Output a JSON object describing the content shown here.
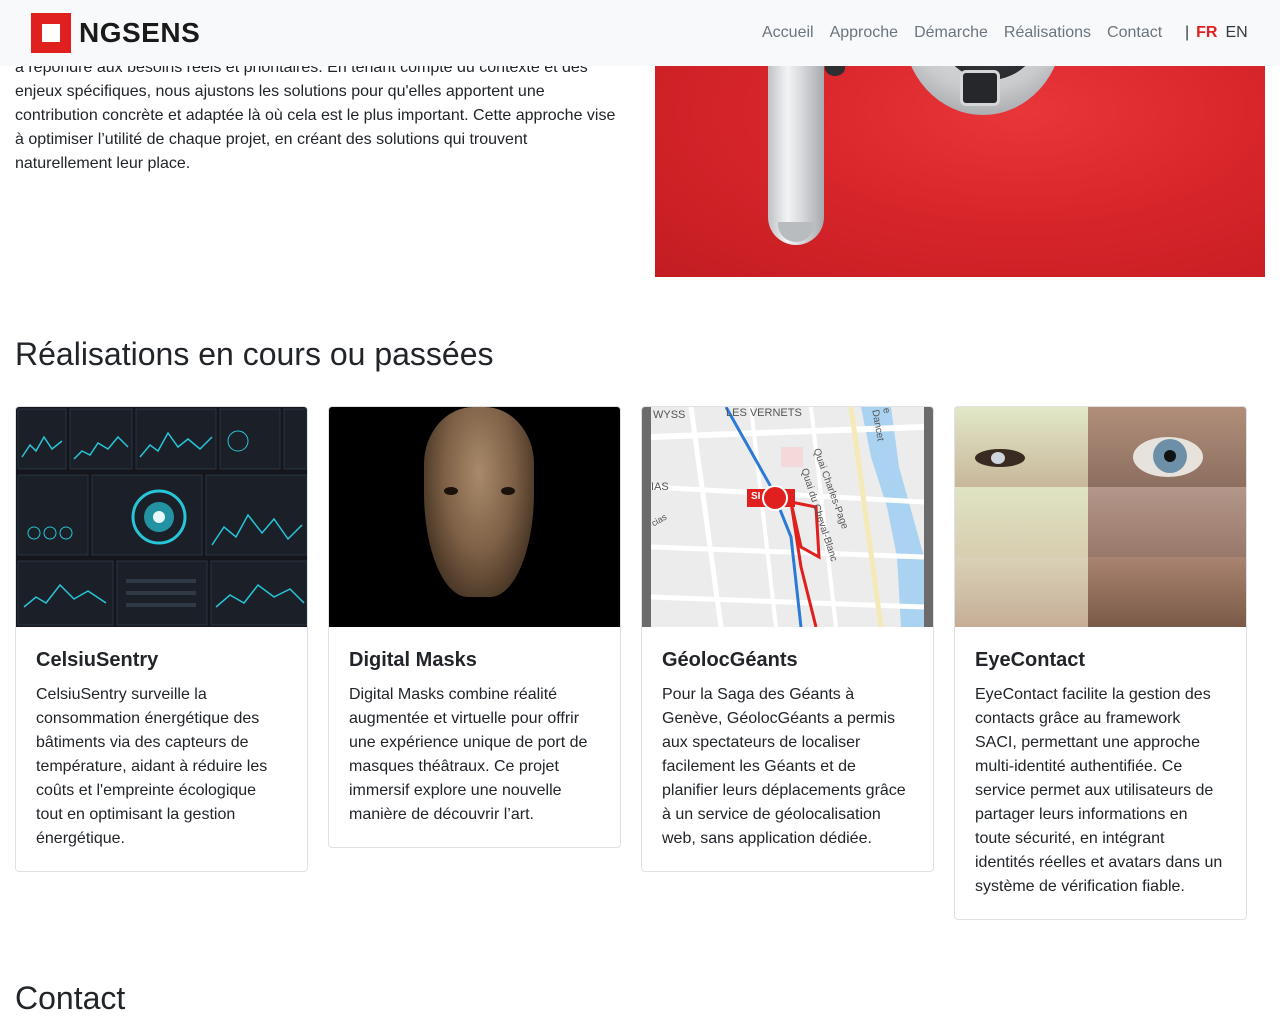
{
  "navbar": {
    "brand": "NGSENS",
    "links": [
      "Accueil",
      "Approche",
      "Démarche",
      "Réalisations",
      "Contact"
    ],
    "lang_separator": "|",
    "lang_active": "FR",
    "lang_other": "EN"
  },
  "intro": {
    "lines": [
      "à répondre aux besoins réels et prioritaires. En tenant compte du contexte et des",
      "enjeux spécifiques, nous ajustons les solutions pour qu'elles apportent une",
      "contribution concrète et adaptée là où cela est le plus important. Cette approche vise",
      "à optimiser l’utilité de chaque projet, en créant des solutions qui trouvent",
      "naturellement leur place."
    ]
  },
  "realisations": {
    "title": "Réalisations en cours ou passées",
    "cards": [
      {
        "title": "CelsiuSentry",
        "text": "CelsiuSentry surveille la consommation énergétique des bâtiments via des capteurs de température, aidant à réduire les coûts et l'empreinte écologique tout en optimisant la gestion énergétique."
      },
      {
        "title": "Digital Masks",
        "text": "Digital Masks combine réalité augmentée et virtuelle pour offrir une expérience unique de port de masques théâtraux. Ce projet immersif explore une nouvelle manière de découvrir l’art."
      },
      {
        "title": "GéolocGéants",
        "text": "Pour la Saga des Géants à Genève, GéolocGéants a permis aux spectateurs de localiser facilement les Géants et de planifier leurs déplacements grâce à un service de géolocalisation web, sans application dédiée."
      },
      {
        "title": "EyeContact",
        "text": "EyeContact facilite la gestion des contacts grâce au framework SACI, permettant une approche multi-identité authentifiée. Ce service permet aux utilisateurs de partager leurs informations en toute sécurité, en intégrant identités réelles et avatars dans un système de vérification fiable."
      }
    ]
  },
  "map_labels": {
    "top_left": "WYSS",
    "top_center": "LES VERNETS",
    "left": "IAS",
    "street1": "Quai Charles-Page",
    "street2": "Quai du Cheval-Blanc",
    "street3": "e Dancet",
    "street4": "cias",
    "marker": "SI"
  },
  "contact": {
    "title": "Contact"
  },
  "colors": {
    "accent": "#e01f1f",
    "nav_text": "#6c757d"
  }
}
